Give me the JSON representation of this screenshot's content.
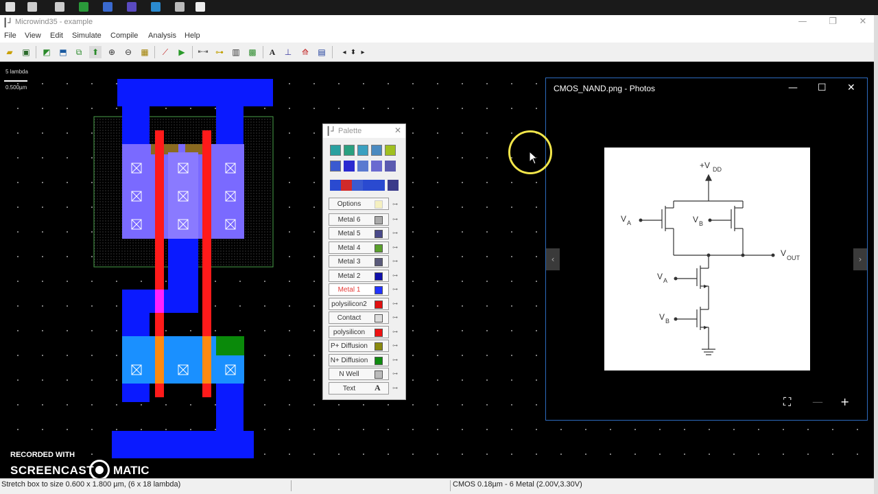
{
  "app": {
    "title": "Microwind35 - example"
  },
  "menu": [
    "File",
    "View",
    "Edit",
    "Simulate",
    "Compile",
    "Analysis",
    "Help"
  ],
  "scale": {
    "label_top": "5 lambda",
    "label_bottom": "0.500µm"
  },
  "palette": {
    "title": "Palette",
    "layers": [
      {
        "label": "Options",
        "color": "#f5f0c0"
      },
      {
        "label": "Metal 6",
        "color": "#888888"
      },
      {
        "label": "Metal 5",
        "color": "#4a4a8a"
      },
      {
        "label": "Metal 4",
        "color": "#5aa02c"
      },
      {
        "label": "Metal 3",
        "color": "#5a5a7a"
      },
      {
        "label": "Metal 2",
        "color": "#1010aa"
      },
      {
        "label": "Metal 1",
        "color": "#2233ff"
      },
      {
        "label": "polysilicon2",
        "color": "#e01010"
      },
      {
        "label": "Contact",
        "color": "#dddddd"
      },
      {
        "label": "polysilicon",
        "color": "#ee1111"
      },
      {
        "label": "P+ Diffusion",
        "color": "#8a8a10"
      },
      {
        "label": "N+ Diffusion",
        "color": "#108a10"
      },
      {
        "label": "N Well",
        "color": "#bbbbbb"
      },
      {
        "label": "Text",
        "color": "#f7f7f7"
      }
    ],
    "active_layer": "Metal 1"
  },
  "photos": {
    "title": "CMOS_NAND.png - Photos",
    "schematic": {
      "vdd": "+V",
      "vdd_sub": "DD",
      "va": "V",
      "va_sub": "A",
      "vb": "V",
      "vb_sub": "B",
      "vout": "V",
      "vout_sub": "OUT"
    }
  },
  "watermark": {
    "line1": "RECORDED WITH",
    "brand_left": "SCREENCAST",
    "brand_right": "MATIC"
  },
  "status": {
    "left": "Stretch box to size 0.600 x 1.800 µm, (6 x 18 lambda)",
    "right": "CMOS 0.18µm - 6 Metal (2.00V,3.30V)"
  },
  "colors": {
    "metal1": "#0a1aff",
    "poly": "#ff1a1a",
    "ndiff": "#0a8a0a",
    "pmos_area": "#7a6aff",
    "nwell_border": "#4aa04a",
    "cursor_ring": "#f2e64a"
  }
}
